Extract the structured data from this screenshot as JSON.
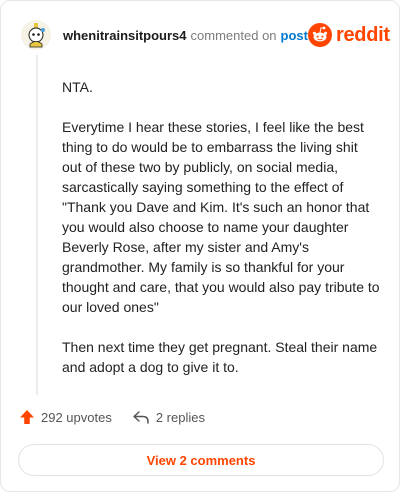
{
  "comment": {
    "username": "whenitrainsitpours4",
    "action": "commented on",
    "post_link": "post",
    "paragraphs": [
      "NTA.",
      "Everytime I hear these stories, I feel like the best thing to do would be to embarrass the living shit out of these two by publicly, on social media, sarcastically saying something to the effect of \"Thank you Dave and Kim. It's such an honor that you would also choose to name your daughter Beverly Rose, after my sister and Amy's grandmother. My family is so thankful for your thought and care, that you would also pay tribute to our loved ones\"",
      "Then next time they get pregnant. Steal their name and adopt a dog to give it to."
    ]
  },
  "brand": {
    "wordmark": "reddit",
    "icon": "reddit-logo-icon"
  },
  "stats": {
    "upvotes": "292 upvotes",
    "replies": "2 replies",
    "upvote_icon": "upvote-arrow-icon",
    "reply_icon": "reply-arrow-icon"
  },
  "actions": {
    "view_comments": "View 2 comments"
  },
  "colors": {
    "accent": "#ff4500",
    "link": "#0079d3"
  }
}
